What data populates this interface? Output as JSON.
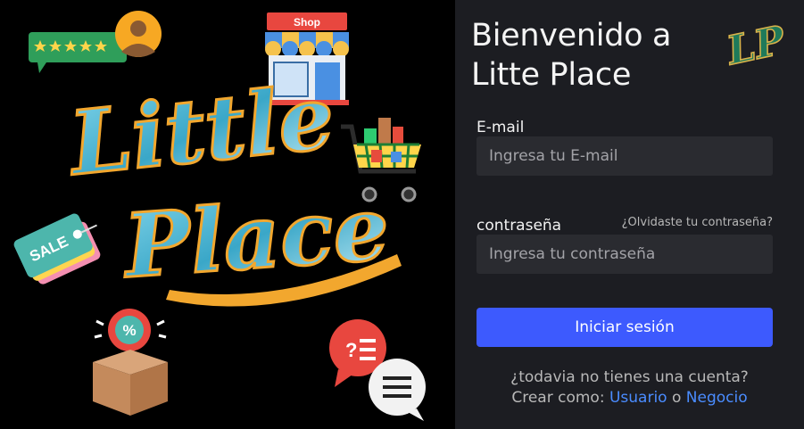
{
  "brand": {
    "hero_title_line1": "Little",
    "hero_title_line2": "Place",
    "logo_monogram": "LP"
  },
  "stickers": {
    "shop_sign": "Shop",
    "sale_tag": "SALE",
    "discount_symbol": "%"
  },
  "login": {
    "welcome_line1": "Bienvenido a",
    "welcome_line2": "Litte Place",
    "email_label": "E-mail",
    "email_placeholder": "Ingresa tu E-mail",
    "password_label": "contraseña",
    "password_placeholder": "Ingresa tu contraseña",
    "forgot_link": "¿Olvidaste tu contraseña?",
    "submit_label": "Iniciar sesión",
    "no_account_text": "¿todavia no tienes una cuenta?",
    "create_as_text": "Crear como:",
    "user_link": "Usuario",
    "or_text": "o",
    "business_link": "Negocio"
  },
  "colors": {
    "primary_button": "#3d5afe",
    "link": "#4a8cff",
    "panel_bg": "#1c1d22",
    "input_bg": "#2a2b30"
  }
}
